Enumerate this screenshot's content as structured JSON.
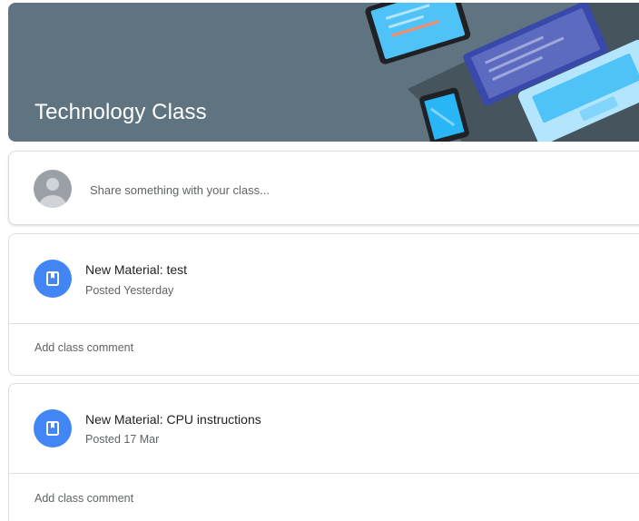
{
  "header": {
    "class_title": "Technology Class"
  },
  "composer": {
    "placeholder": "Share something with your class..."
  },
  "posts": [
    {
      "title": "New Material: test",
      "posted": "Posted Yesterday",
      "comment_label": "Add class comment"
    },
    {
      "title": "New Material: CPU instructions",
      "posted": "Posted 17 Mar",
      "comment_label": "Add class comment"
    }
  ],
  "colors": {
    "banner": "#5f7480",
    "accent": "#4285f4"
  },
  "icons": {
    "avatar": "person-avatar-icon",
    "post": "material-book-icon"
  }
}
